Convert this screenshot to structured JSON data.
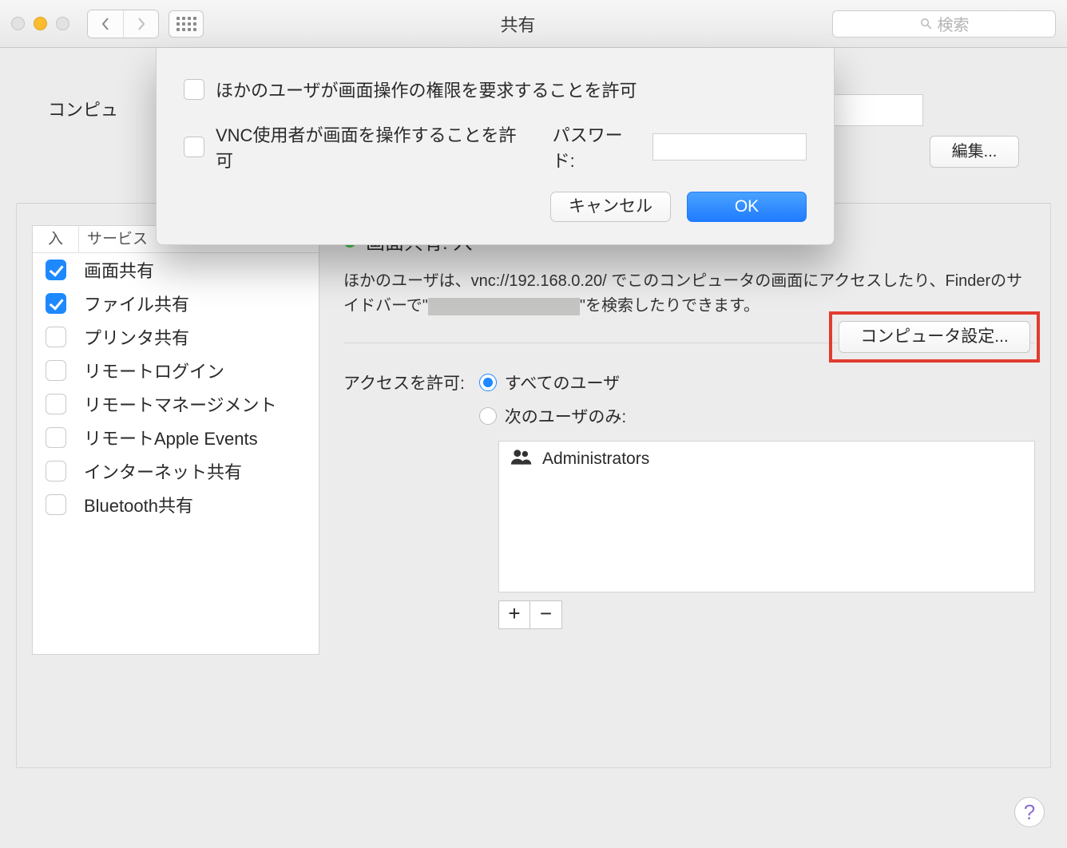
{
  "window": {
    "title": "共有",
    "search_placeholder": "検索"
  },
  "computer_name": {
    "label_partial": "コンピュ",
    "edit_button": "編集..."
  },
  "services": {
    "header_on": "入",
    "header_service": "サービス",
    "items": [
      {
        "label": "画面共有",
        "checked": true
      },
      {
        "label": "ファイル共有",
        "checked": true
      },
      {
        "label": "プリンタ共有",
        "checked": false
      },
      {
        "label": "リモートログイン",
        "checked": false
      },
      {
        "label": "リモートマネージメント",
        "checked": false
      },
      {
        "label": "リモートApple Events",
        "checked": false
      },
      {
        "label": "インターネット共有",
        "checked": false
      },
      {
        "label": "Bluetooth共有",
        "checked": false
      }
    ]
  },
  "status": {
    "title": "画面共有: 入",
    "desc_a": "ほかのユーザは、vnc://192.168.0.20/ でこのコンピュータの画面にアクセスしたり、Finderのサイドバーで\"",
    "desc_b": "\"を検索したりできます。",
    "config_button": "コンピュータ設定..."
  },
  "access": {
    "label": "アクセスを許可:",
    "opt_all": "すべてのユーザ",
    "opt_only": "次のユーザのみ:",
    "users": [
      "Administrators"
    ]
  },
  "sheet": {
    "allow_request": "ほかのユーザが画面操作の権限を要求することを許可",
    "vnc_control": "VNC使用者が画面を操作することを許可",
    "password_label": "パスワード:",
    "cancel": "キャンセル",
    "ok": "OK"
  }
}
